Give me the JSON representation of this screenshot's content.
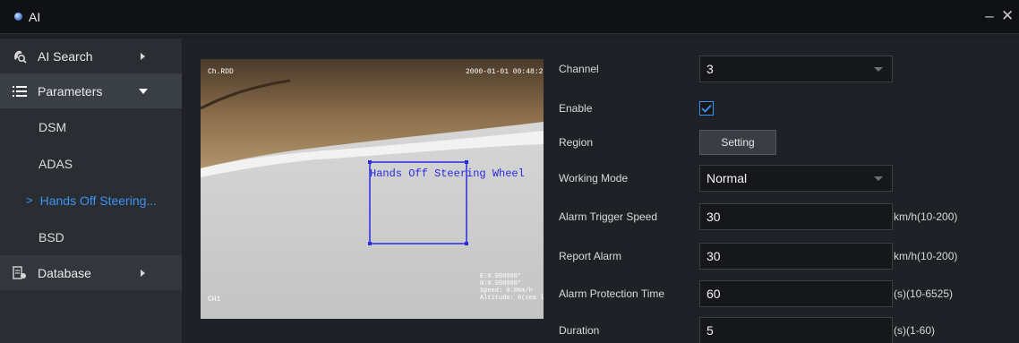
{
  "window": {
    "title": "AI",
    "minimize": "–",
    "close": "✕"
  },
  "sidebar": {
    "ai_search": "AI Search",
    "parameters": "Parameters",
    "sub_items": [
      "DSM",
      "ADAS",
      "Hands Off Steering...",
      "BSD"
    ],
    "active_arrow": ">",
    "database": "Database"
  },
  "preview": {
    "top_left": "Ch.RDD",
    "timestamp": "2000-01-01 00:48:28",
    "detection_label": "Hands Off Steering Wheel",
    "bottom_left": "CH1",
    "bottom_right": [
      "E:0.000000°",
      "N:0.000000°",
      "Speed: 0.0Km/h",
      "Altitude: 0(sea level)"
    ]
  },
  "form": {
    "channel": {
      "label": "Channel",
      "value": "3"
    },
    "enable": {
      "label": "Enable",
      "checked": true
    },
    "region": {
      "label": "Region",
      "button": "Setting"
    },
    "working_mode": {
      "label": "Working Mode",
      "value": "Normal"
    },
    "alarm_trigger_speed": {
      "label": "Alarm Trigger Speed",
      "value": "30",
      "unit": "km/h(10-200)"
    },
    "report_alarm": {
      "label": "Report Alarm",
      "value": "30",
      "unit": "km/h(10-200)"
    },
    "alarm_protection_time": {
      "label": "Alarm Protection Time",
      "value": "60",
      "unit": "(s)(10-6525)"
    },
    "duration": {
      "label": "Duration",
      "value": "5",
      "unit": "(s)(1-60)"
    }
  },
  "colors": {
    "accent": "#3b93f3",
    "detection_box": "#2a2adf",
    "background": "#1e2126",
    "sidebar": "#2a2e33"
  }
}
